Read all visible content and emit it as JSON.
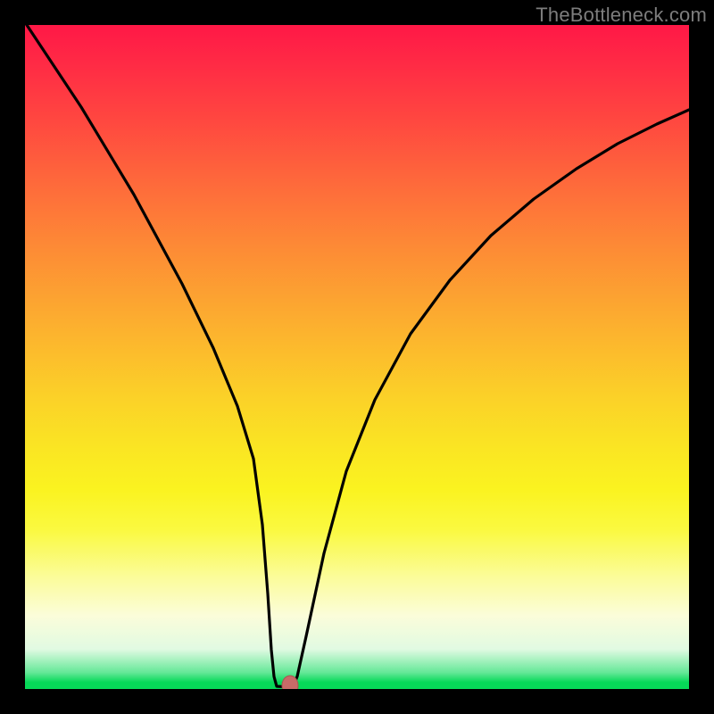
{
  "watermark": "TheBottleneck.com",
  "colors": {
    "frame": "#000000",
    "curve": "#000000",
    "marker_fill": "#c86b68",
    "marker_stroke": "#a85552",
    "gradient_top": "#ff1846",
    "gradient_bottom": "#07d958"
  },
  "chart_data": {
    "type": "line",
    "title": "",
    "xlabel": "",
    "ylabel": "",
    "xlim": [
      0,
      100
    ],
    "ylim": [
      0,
      100
    ],
    "grid": false,
    "legend": false,
    "comment": "V-shaped bottleneck curve; y=0 at the matched point, rising toward 100 on both sides. Values below are approximate readings from the plot (x as % of horizontal extent, y as % of vertical extent).",
    "series": [
      {
        "name": "bottleneck-curve-left",
        "x": [
          0,
          4,
          8,
          12,
          16,
          20,
          24,
          28,
          31,
          33,
          35,
          36.5,
          38
        ],
        "y": [
          100,
          89,
          78,
          67,
          56,
          46,
          35,
          24,
          14,
          8,
          3,
          0.5,
          0
        ]
      },
      {
        "name": "bottleneck-curve-right",
        "x": [
          40,
          42,
          45,
          48,
          52,
          56,
          60,
          65,
          70,
          75,
          80,
          85,
          90,
          95,
          100
        ],
        "y": [
          0.5,
          4,
          12,
          20,
          30,
          38,
          45,
          53,
          60,
          66,
          71,
          76,
          80,
          84,
          87
        ]
      }
    ],
    "markers": [
      {
        "name": "optimum-point",
        "x": 39,
        "y": 0
      }
    ]
  }
}
